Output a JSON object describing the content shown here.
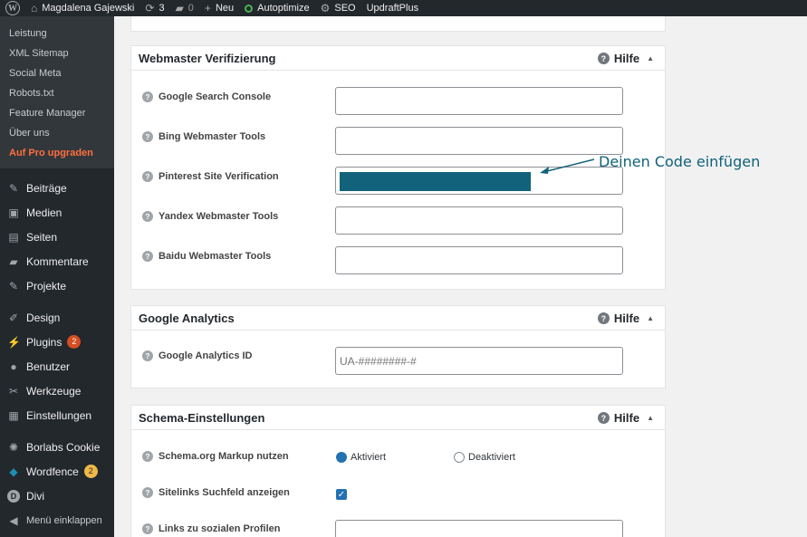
{
  "adminbar": {
    "user": "Magdalena Gajewski",
    "updates": "3",
    "comments": "0",
    "new": "Neu",
    "autoptimize": "Autoptimize",
    "seo": "SEO",
    "updraft": "UpdraftPlus"
  },
  "sidebar": {
    "submenu": [
      "Leistung",
      "XML Sitemap",
      "Social Meta",
      "Robots.txt",
      "Feature Manager",
      "Über uns"
    ],
    "pro": "Auf Pro upgraden",
    "items": [
      {
        "label": "Beiträge",
        "icon": "pin-icon"
      },
      {
        "label": "Medien",
        "icon": "media-icon"
      },
      {
        "label": "Seiten",
        "icon": "page-icon"
      },
      {
        "label": "Kommentare",
        "icon": "comment-icon"
      },
      {
        "label": "Projekte",
        "icon": "pin-icon"
      }
    ],
    "items2": [
      {
        "label": "Design",
        "icon": "brush-icon"
      },
      {
        "label": "Plugins",
        "badge": "2",
        "icon": "plug-icon"
      },
      {
        "label": "Benutzer",
        "icon": "user-icon"
      },
      {
        "label": "Werkzeuge",
        "icon": "wrench-icon"
      },
      {
        "label": "Einstellungen",
        "icon": "settings-icon"
      }
    ],
    "items3": [
      {
        "label": "Borlabs Cookie",
        "icon": "cookie-icon"
      },
      {
        "label": "Wordfence",
        "badge": "2",
        "icon": "shield-icon"
      },
      {
        "label": "Divi",
        "icon": "divi-icon"
      },
      {
        "label": "Menü einklappen",
        "icon": "collapse-icon"
      }
    ]
  },
  "webmaster": {
    "title": "Webmaster Verifizierung",
    "help": "Hilfe",
    "fields": [
      {
        "label": "Google Search Console",
        "value": ""
      },
      {
        "label": "Bing Webmaster Tools",
        "value": ""
      },
      {
        "label": "Pinterest Site Verification",
        "value": ""
      },
      {
        "label": "Yandex Webmaster Tools",
        "value": ""
      },
      {
        "label": "Baidu Webmaster Tools",
        "value": ""
      }
    ]
  },
  "analytics": {
    "title": "Google Analytics",
    "help": "Hilfe",
    "label": "Google Analytics ID",
    "placeholder": "UA-########-#"
  },
  "schema": {
    "title": "Schema-Einstellungen",
    "help": "Hilfe",
    "markup_label": "Schema.org Markup nutzen",
    "on": "Aktiviert",
    "off": "Deaktiviert",
    "sitelinks_label": "Sitelinks Suchfeld anzeigen",
    "social_label": "Links zu sozialen Profilen"
  },
  "annotation": "Deinen Code einfügen",
  "colors": {
    "accent": "#2271b1",
    "highlight": "#11627a",
    "pro": "#ff6f3b"
  }
}
